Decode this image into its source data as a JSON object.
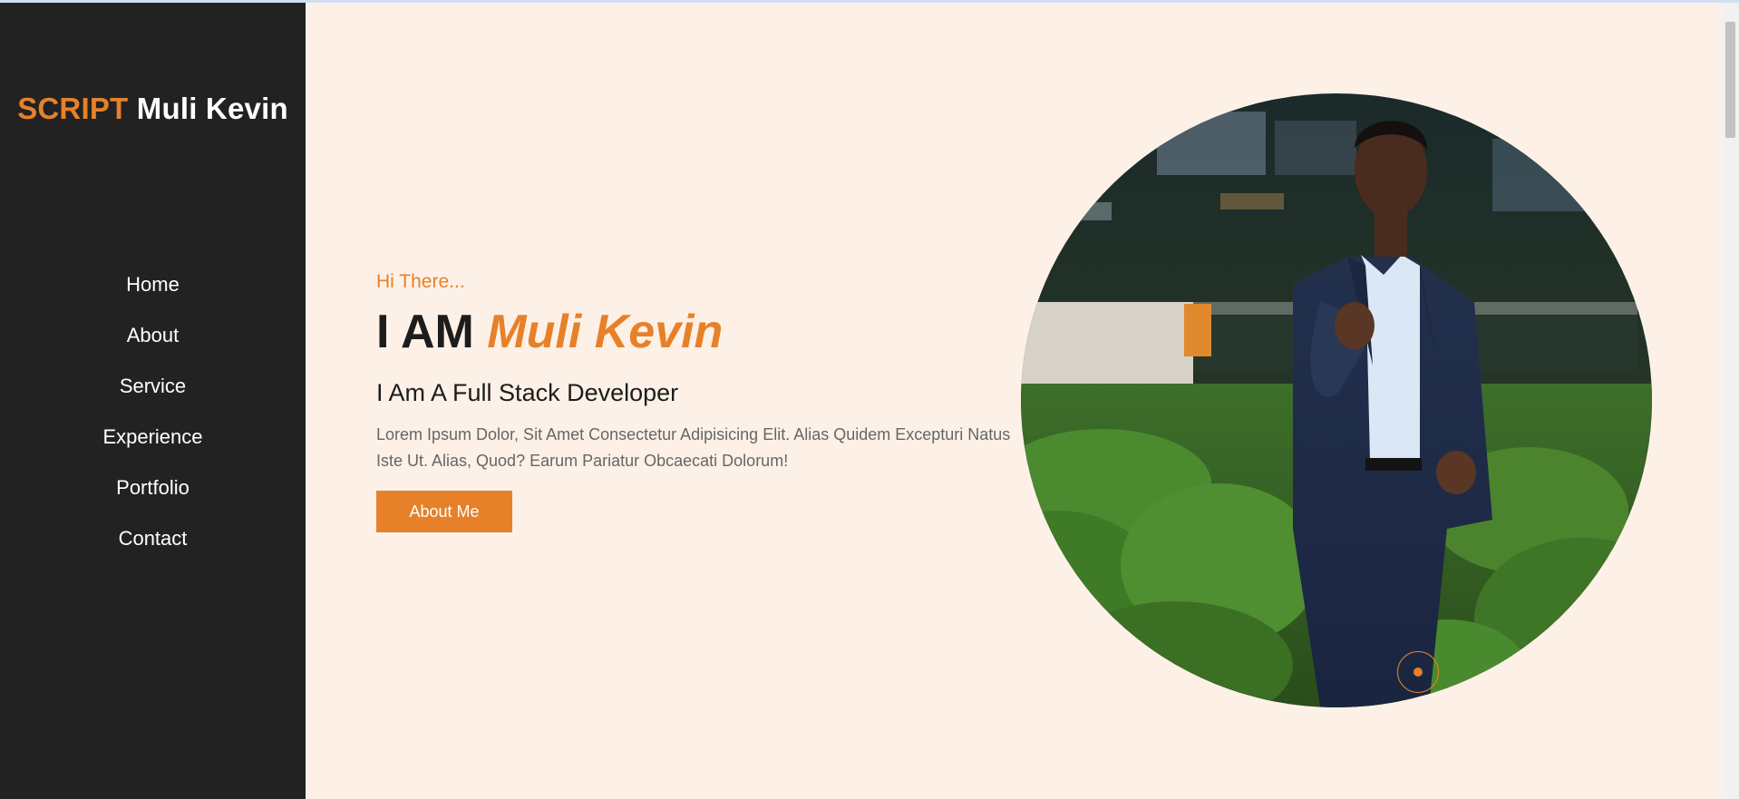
{
  "logo": {
    "accent": "SCRIPT",
    "name": "Muli Kevin"
  },
  "nav": {
    "items": [
      "Home",
      "About",
      "Service",
      "Experience",
      "Portfolio",
      "Contact"
    ]
  },
  "hero": {
    "greeting": "Hi There...",
    "headline_prefix": "I AM",
    "headline_name": "Muli Kevin",
    "role": "I Am A Full Stack Developer",
    "description": "Lorem Ipsum Dolor, Sit Amet Consectetur Adipisicing Elit. Alias Quidem Excepturi Natus Iste Ut. Alias, Quod? Earum Pariatur Obcaecati Dolorum!",
    "button_label": "About Me"
  },
  "colors": {
    "accent": "#e6812a",
    "sidebar_bg": "#222222",
    "page_bg": "#fdf1e7"
  }
}
